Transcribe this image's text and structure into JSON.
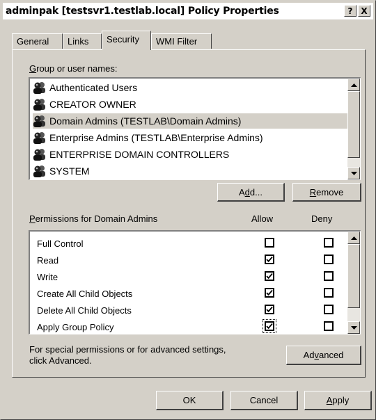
{
  "window": {
    "title": "adminpak [testsvr1.testlab.local] Policy Properties",
    "help_label": "?",
    "close_label": "X"
  },
  "tabs": [
    {
      "label": "General"
    },
    {
      "label": "Links"
    },
    {
      "label": "Security",
      "active": true
    },
    {
      "label": "WMI Filter"
    }
  ],
  "security": {
    "group_label_first": "G",
    "group_label_rest": "roup or user names:",
    "users": [
      {
        "name": "Authenticated Users",
        "icon": "user-group-icon"
      },
      {
        "name": "CREATOR OWNER",
        "icon": "user-group-icon"
      },
      {
        "name": "Domain Admins (TESTLAB\\Domain Admins)",
        "icon": "user-group-icon",
        "selected": true
      },
      {
        "name": "Enterprise Admins (TESTLAB\\Enterprise Admins)",
        "icon": "user-group-icon"
      },
      {
        "name": "ENTERPRISE DOMAIN CONTROLLERS",
        "icon": "user-group-icon"
      },
      {
        "name": "SYSTEM",
        "icon": "user-group-icon"
      }
    ],
    "add_pre": "A",
    "add_u": "d",
    "add_post": "d...",
    "remove_u": "R",
    "remove_post": "emove",
    "perm_label_u": "P",
    "perm_label_rest": "ermissions for Domain Admins",
    "allow_header": "Allow",
    "deny_header": "Deny",
    "permissions": [
      {
        "name": "Full Control",
        "allow": false,
        "deny": false
      },
      {
        "name": "Read",
        "allow": true,
        "deny": false
      },
      {
        "name": "Write",
        "allow": true,
        "deny": false
      },
      {
        "name": "Create All Child Objects",
        "allow": true,
        "deny": false
      },
      {
        "name": "Delete All Child Objects",
        "allow": true,
        "deny": false
      },
      {
        "name": "Apply Group Policy",
        "allow": true,
        "deny": false,
        "focused": true
      }
    ],
    "advanced_text_line1": "For special permissions or for advanced settings,",
    "advanced_text_line2": "click Advanced.",
    "advanced_pre": "Ad",
    "advanced_u": "v",
    "advanced_post": "anced"
  },
  "footer": {
    "ok_label": "OK",
    "cancel_label": "Cancel",
    "apply_u": "A",
    "apply_post": "pply"
  }
}
